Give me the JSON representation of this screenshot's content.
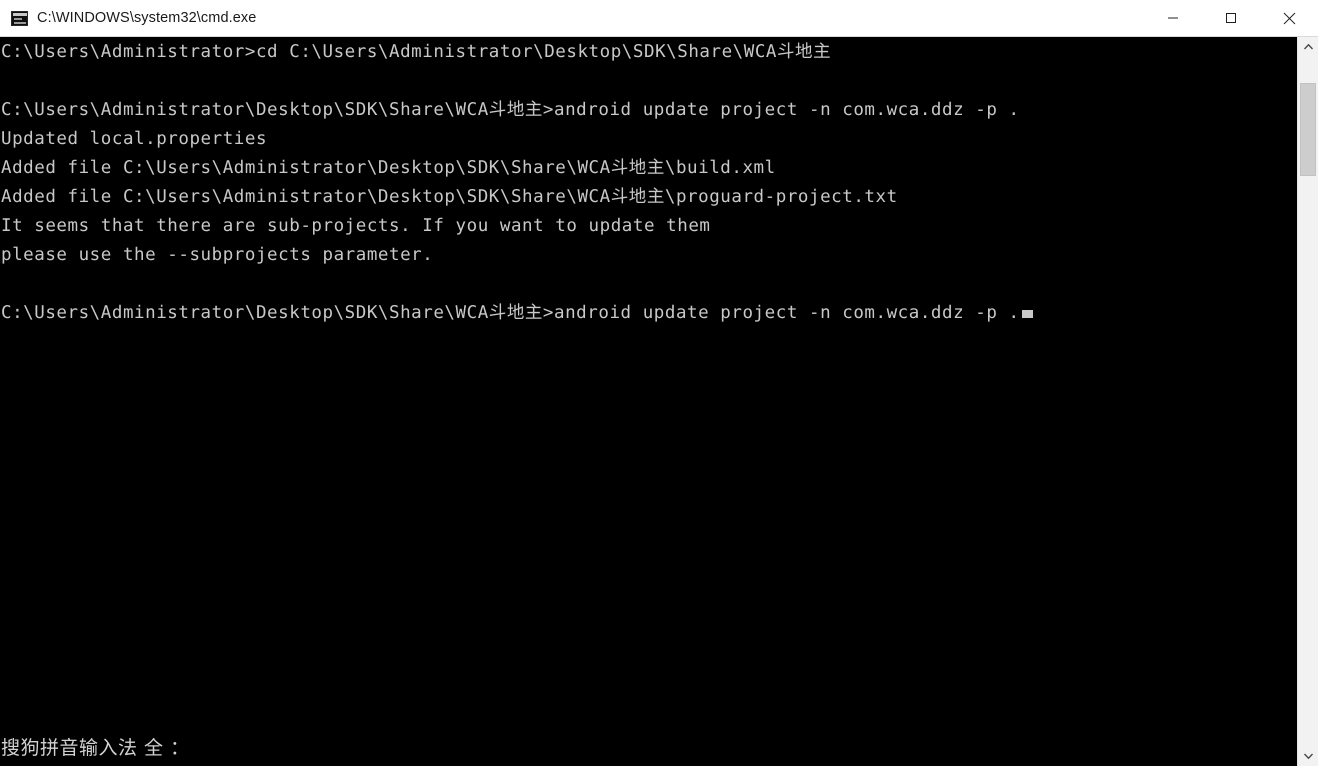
{
  "window": {
    "title": "C:\\WINDOWS\\system32\\cmd.exe",
    "icon": "cmd-console-icon",
    "background_color": "#000000",
    "titlebar_color": "#ffffff",
    "text_color": "#c8c8c8"
  },
  "controls": {
    "minimize_label": "Minimize",
    "maximize_label": "Maximize",
    "close_label": "Close"
  },
  "console": {
    "lines": [
      "C:\\Users\\Administrator>cd C:\\Users\\Administrator\\Desktop\\SDK\\Share\\WCA斗地主",
      "",
      "C:\\Users\\Administrator\\Desktop\\SDK\\Share\\WCA斗地主>android update project -n com.wca.ddz -p .",
      "Updated local.properties",
      "Added file C:\\Users\\Administrator\\Desktop\\SDK\\Share\\WCA斗地主\\build.xml",
      "Added file C:\\Users\\Administrator\\Desktop\\SDK\\Share\\WCA斗地主\\proguard-project.txt",
      "It seems that there are sub-projects. If you want to update them",
      "please use the --subprojects parameter.",
      ""
    ],
    "prompt_line": "C:\\Users\\Administrator\\Desktop\\SDK\\Share\\WCA斗地主>android update project -n com.wca.ddz -p .",
    "cursor_visible": "true"
  },
  "ime": {
    "status_text": "搜狗拼音输入法 全 ："
  },
  "scrollbar": {
    "up_arrow": "chevron-up-icon",
    "down_arrow": "chevron-down-icon",
    "thumb_position": "near-top"
  }
}
